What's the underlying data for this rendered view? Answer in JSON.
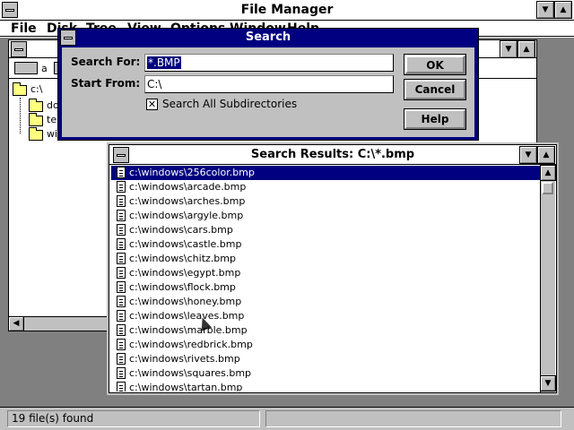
{
  "app": {
    "title": "File Manager",
    "menu": [
      "File",
      "Disk",
      "Tree",
      "View",
      "Options",
      "Window",
      "Help"
    ]
  },
  "directory_window": {
    "drive_label": "a",
    "tree": [
      {
        "label": "c:\\",
        "icon": "open-folder-icon"
      },
      {
        "label": "do",
        "icon": "folder-icon"
      },
      {
        "label": "te",
        "icon": "folder-icon"
      },
      {
        "label": "wi",
        "icon": "folder-icon"
      }
    ]
  },
  "search_dialog": {
    "title": "Search",
    "search_for_label": "Search For:",
    "search_for_value": "*.BMP",
    "start_from_label": "Start From:",
    "start_from_value": "C:\\",
    "subdirs_label": "Search All Subdirectories",
    "subdirs_checked": true,
    "ok_label": "OK",
    "cancel_label": "Cancel",
    "help_label": "Help"
  },
  "results": {
    "title": "Search Results: C:\\*.bmp",
    "selected_index": 0,
    "files": [
      "c:\\windows\\256color.bmp",
      "c:\\windows\\arcade.bmp",
      "c:\\windows\\arches.bmp",
      "c:\\windows\\argyle.bmp",
      "c:\\windows\\cars.bmp",
      "c:\\windows\\castle.bmp",
      "c:\\windows\\chitz.bmp",
      "c:\\windows\\egypt.bmp",
      "c:\\windows\\flock.bmp",
      "c:\\windows\\honey.bmp",
      "c:\\windows\\leaves.bmp",
      "c:\\windows\\marble.bmp",
      "c:\\windows\\redbrick.bmp",
      "c:\\windows\\rivets.bmp",
      "c:\\windows\\squares.bmp",
      "c:\\windows\\tartan.bmp"
    ]
  },
  "status": {
    "text": "19 file(s) found"
  },
  "colors": {
    "titlebar_active": "#000080",
    "face": "#c0c0c0",
    "desktop": "#808080"
  }
}
